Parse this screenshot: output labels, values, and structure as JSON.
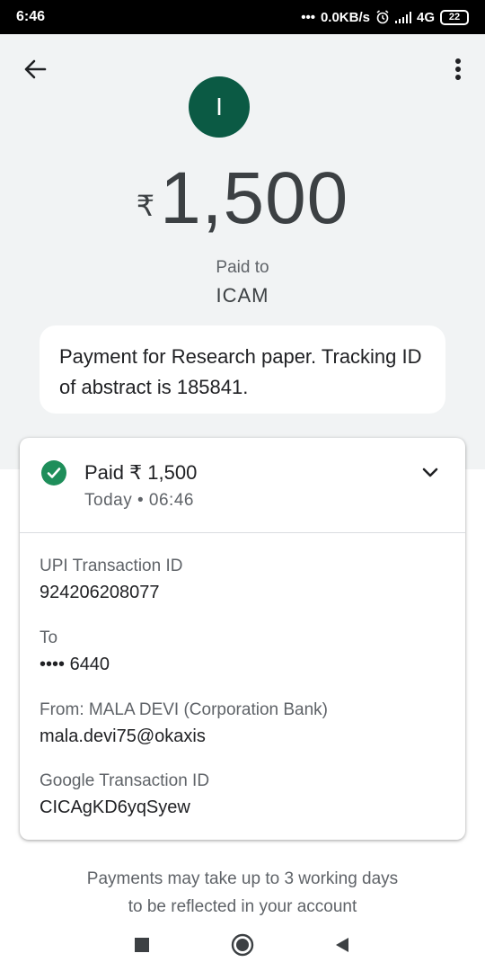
{
  "status_bar": {
    "time": "6:46",
    "network_speed": "0.0KB/s",
    "network_type": "4G",
    "battery": "22",
    "icons": [
      "dots-icon",
      "alarm-icon",
      "signal-icon"
    ]
  },
  "header": {
    "back_icon": "arrow-back-icon",
    "menu_icon": "more-vert-icon"
  },
  "payee": {
    "avatar_letter": "I",
    "avatar_color": "#0b5a44",
    "name": "ICAM"
  },
  "payment": {
    "currency_symbol": "₹",
    "amount": "1,500",
    "paid_to_label": "Paid to",
    "note": "Payment for Research paper. Tracking ID of abstract is 185841."
  },
  "summary": {
    "status_icon": "check-circle-icon",
    "status_color": "#1e8e5a",
    "status_text": "Paid ₹ 1,500",
    "time_text": "Today • 06:46",
    "expand_icon": "chevron-down-icon"
  },
  "details": {
    "upi_label": "UPI Transaction ID",
    "upi_value": "924206208077",
    "to_label": "To",
    "to_value": "•••• 6440",
    "from_label": "From: MALA DEVI (Corporation Bank)",
    "from_value": "mala.devi75@okaxis",
    "google_label": "Google Transaction ID",
    "google_value": "CICAgKD6yqSyew"
  },
  "footer": {
    "line1": "Payments may take up to 3 working days",
    "line2": "to be reflected in your account"
  },
  "nav_bar": {
    "recents_icon": "square-icon",
    "home_icon": "circle-icon",
    "back_icon": "triangle-back-icon"
  }
}
